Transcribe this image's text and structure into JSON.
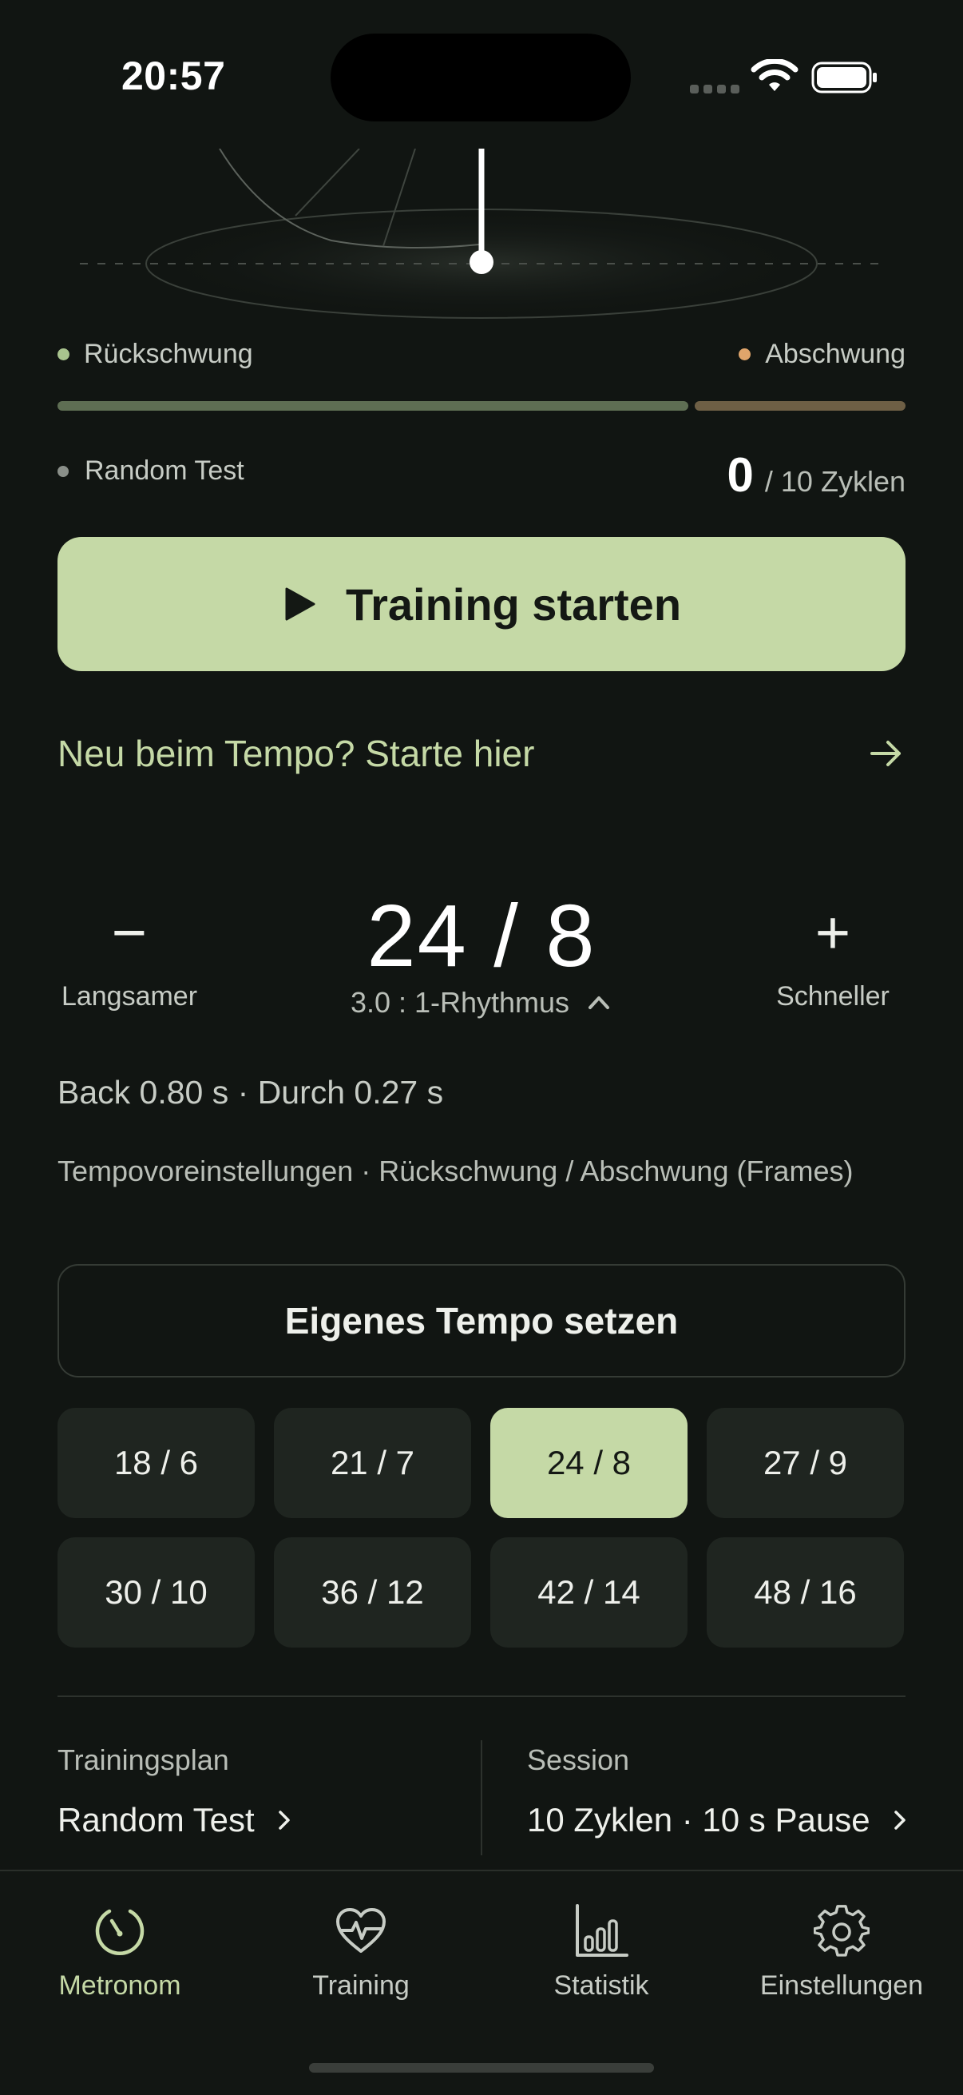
{
  "status_bar": {
    "time": "20:57"
  },
  "legend": {
    "back_label": "Rückschwung",
    "down_label": "Abschwung",
    "back_color": "#a9c48e",
    "down_color": "#e0a56b"
  },
  "session_info": {
    "plan_name": "Random Test",
    "cycles_done": "0",
    "cycles_total": "/ 10 Zyklen"
  },
  "start_button": {
    "label": "Training starten",
    "icon": "play-icon"
  },
  "intro_link": {
    "label": "Neu beim Tempo? Starte hier",
    "icon": "arrow-right-icon"
  },
  "tempo": {
    "minus_glyph": "−",
    "minus_label": "Langsamer",
    "plus_glyph": "+",
    "plus_label": "Schneller",
    "value": "24 / 8",
    "ratio": "3.0 : 1-Rhythmus"
  },
  "timing": "Back 0.80 s · Durch 0.27 s",
  "presets": {
    "title": "Tempovoreinstellungen · Rückschwung / Abschwung (Frames)",
    "custom_button": "Eigenes Tempo setzen",
    "items": [
      "18 / 6",
      "21 / 7",
      "24 / 8",
      "27 / 9",
      "30 / 10",
      "36 / 12",
      "42 / 14",
      "48 / 16"
    ],
    "selected": "24 / 8"
  },
  "footer": {
    "plan_title": "Trainingsplan",
    "plan_value": "Random Test",
    "session_title": "Session",
    "session_value": "10 Zyklen · 10 s Pause"
  },
  "tabs": [
    {
      "label": "Metronom",
      "icon": "metronome-icon",
      "active": true
    },
    {
      "label": "Training",
      "icon": "heart-pulse-icon",
      "active": false
    },
    {
      "label": "Statistik",
      "icon": "bar-chart-icon",
      "active": false
    },
    {
      "label": "Einstellungen",
      "icon": "gear-icon",
      "active": false
    }
  ],
  "colors": {
    "accent": "#c5d9a6",
    "background": "#111512",
    "tile": "#1f2520"
  }
}
